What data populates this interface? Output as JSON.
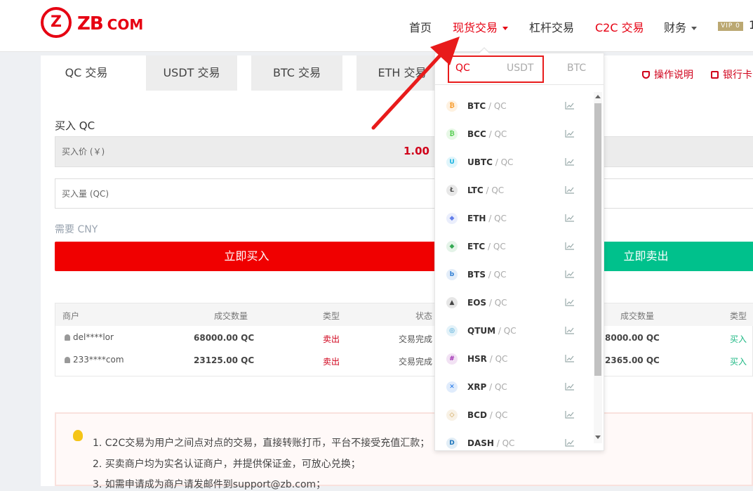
{
  "brand": {
    "logo_mark": "Z",
    "name": "ZB",
    "suffix": "COM"
  },
  "nav": {
    "home": "首页",
    "spot": "现货交易",
    "leverage": "杠杆交易",
    "c2c": "C2C 交易",
    "finance": "财务",
    "vip": "VIP 0",
    "tail": "1"
  },
  "tabs": [
    "QC 交易",
    "USDT 交易",
    "BTC 交易",
    "ETH 交易"
  ],
  "links": {
    "guide": "操作说明",
    "bank": "银行卡"
  },
  "buy": {
    "title": "买入 QC",
    "price_label": "买入价 (￥)",
    "price_value": "1.00",
    "qty_placeholder": "买入量 (QC)",
    "need": "需要 CNY",
    "button": "立即买入"
  },
  "sell": {
    "button": "立即卖出"
  },
  "table": {
    "headers": [
      "商户",
      "成交数量",
      "类型",
      "状态"
    ],
    "right_headers": [
      "成交数量",
      "类型"
    ],
    "rows": [
      {
        "merchant": "del****lor",
        "amount": "68000.00 QC",
        "type": "卖出",
        "status": "交易完成",
        "right_amount": "8000.00 QC",
        "right_type": "买入"
      },
      {
        "merchant": "233****com",
        "amount": "23125.00 QC",
        "type": "卖出",
        "status": "交易完成",
        "right_amount": "2365.00 QC",
        "right_type": "买入"
      }
    ]
  },
  "notice": [
    "1. C2C交易为用户之间点对点的交易，直接转账打币，平台不接受充值汇款；",
    "2. 买卖商户均为实名认证商户，并提供保证金，可放心兑换；",
    "3. 如需申请成为商户请发邮件到support@zb.com；"
  ],
  "dropdown": {
    "tabs": [
      "QC",
      "USDT",
      "BTC"
    ],
    "pairs": [
      {
        "coin": "BTC",
        "quote": " / QC",
        "icon": "bitcoin-icon",
        "color": "#f7931a",
        "glyph": "₿"
      },
      {
        "coin": "BCC",
        "quote": " / QC",
        "icon": "bitcoin-cash-icon",
        "color": "#4cca47",
        "glyph": "₿"
      },
      {
        "coin": "UBTC",
        "quote": " / QC",
        "icon": "ubtc-icon",
        "color": "#1ab3e0",
        "glyph": "U"
      },
      {
        "coin": "LTC",
        "quote": " / QC",
        "icon": "litecoin-icon",
        "color": "#555555",
        "glyph": "Ł"
      },
      {
        "coin": "ETH",
        "quote": " / QC",
        "icon": "ethereum-icon",
        "color": "#627eea",
        "glyph": "◆"
      },
      {
        "coin": "ETC",
        "quote": " / QC",
        "icon": "ethereum-classic-icon",
        "color": "#34a853",
        "glyph": "◆"
      },
      {
        "coin": "BTS",
        "quote": " / QC",
        "icon": "bitshares-icon",
        "color": "#2a7bd3",
        "glyph": "b"
      },
      {
        "coin": "EOS",
        "quote": " / QC",
        "icon": "eos-icon",
        "color": "#444444",
        "glyph": "▲"
      },
      {
        "coin": "QTUM",
        "quote": " / QC",
        "icon": "qtum-icon",
        "color": "#2e9ad0",
        "glyph": "◎"
      },
      {
        "coin": "HSR",
        "quote": " / QC",
        "icon": "hshare-icon",
        "color": "#9c27b0",
        "glyph": "#"
      },
      {
        "coin": "XRP",
        "quote": " / QC",
        "icon": "ripple-icon",
        "color": "#1a73e8",
        "glyph": "✕"
      },
      {
        "coin": "BCD",
        "quote": " / QC",
        "icon": "bitcoin-diamond-icon",
        "color": "#c8963e",
        "glyph": "◇"
      },
      {
        "coin": "DASH",
        "quote": " / QC",
        "icon": "dash-icon",
        "color": "#1c75bc",
        "glyph": "D"
      }
    ]
  },
  "colors": {
    "accent": "#e60012",
    "buy": "#f00000",
    "sell": "#00c18c",
    "annotation": "#e81b1b"
  }
}
